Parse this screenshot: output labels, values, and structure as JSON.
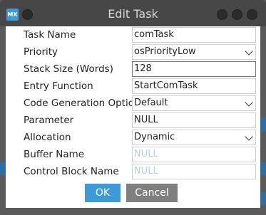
{
  "window": {
    "title": "Edit Task",
    "logo": "MX"
  },
  "fields": [
    {
      "label": "Task Name",
      "value": "comTask"
    },
    {
      "label": "Priority",
      "value": "osPriorityLow"
    },
    {
      "label": "Stack Size (Words)",
      "value": "128"
    },
    {
      "label": "Entry Function",
      "value": "StartComTask"
    },
    {
      "label": "Code Generation Option",
      "value": "Default"
    },
    {
      "label": "Parameter",
      "value": "NULL"
    },
    {
      "label": "Allocation",
      "value": "Dynamic"
    },
    {
      "label": "Buffer Name",
      "placeholder": "NULL"
    },
    {
      "label": "Control Block Name",
      "placeholder": "NULL"
    }
  ],
  "buttons": {
    "ok": "OK",
    "cancel": "Cancel"
  },
  "colors": {
    "accent": "#3c9ad7",
    "secondary": "#7f7f7f",
    "titlebar": "#474747"
  }
}
